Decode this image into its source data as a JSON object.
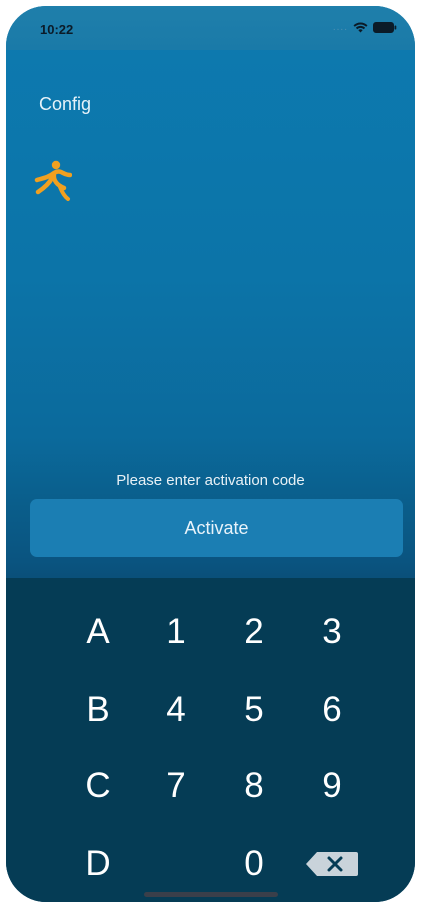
{
  "status_bar": {
    "time": "10:22",
    "signal": "....",
    "wifi_icon": "wifi-icon",
    "battery_icon": "battery-icon"
  },
  "header": {
    "config_label": "Config",
    "logo_icon": "running-person-logo",
    "logo_color": "#f0a020"
  },
  "activation": {
    "prompt": "Please enter activation code",
    "button_label": "Activate",
    "code_value": ""
  },
  "keypad": {
    "keys": [
      [
        "A",
        "1",
        "2",
        "3"
      ],
      [
        "B",
        "4",
        "5",
        "6"
      ],
      [
        "C",
        "7",
        "8",
        "9"
      ],
      [
        "D",
        "",
        "0",
        "backspace"
      ]
    ],
    "backspace_icon": "backspace-icon"
  },
  "colors": {
    "background_top": "#0d7ab0",
    "keypad_background": "#053c55",
    "button_background": "#1b7eb3",
    "accent": "#f0a020"
  }
}
